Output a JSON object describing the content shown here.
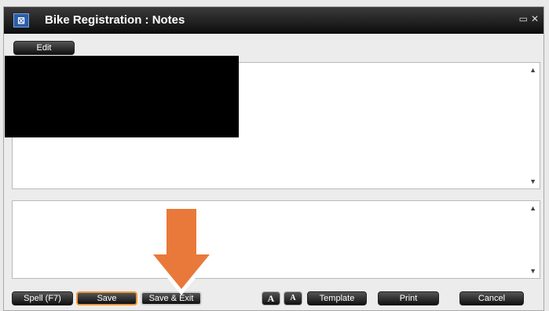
{
  "window": {
    "title": "Bike Registration : Notes",
    "icon": "notes-window-icon",
    "controls": {
      "restore": "▭",
      "close": "✕"
    }
  },
  "toolbar": {
    "edit_label": "Edit"
  },
  "buttons": {
    "spell": "Spell (F7)",
    "save": "Save",
    "save_exit": "Save & Exit",
    "font_increase": "A",
    "font_decrease": "A",
    "template": "Template",
    "print": "Print",
    "cancel": "Cancel"
  },
  "editor": {
    "notes_text": "",
    "new_note_text": ""
  },
  "colors": {
    "annotation_arrow": "#e8793a",
    "save_highlight": "#f09a3e",
    "titlebar": "#1a1a1a"
  }
}
